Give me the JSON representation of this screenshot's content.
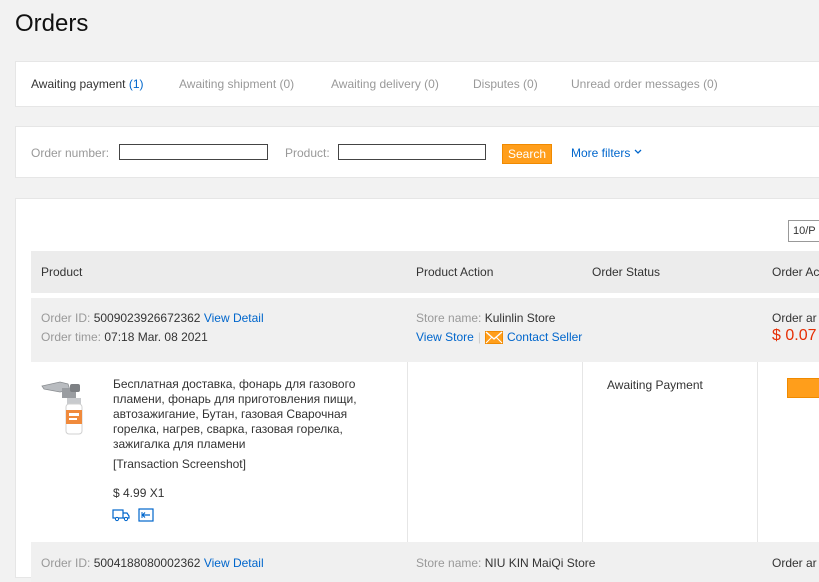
{
  "page": {
    "title": "Orders"
  },
  "tabs": [
    {
      "label": "Awaiting payment",
      "count": "(1)"
    },
    {
      "label": "Awaiting shipment (0)"
    },
    {
      "label": "Awaiting delivery (0)"
    },
    {
      "label": "Disputes (0)"
    },
    {
      "label": "Unread order messages (0)"
    }
  ],
  "filters": {
    "order_number_label": "Order number:",
    "product_label": "Product:",
    "search_label": "Search",
    "more_filters_label": "More filters"
  },
  "pager": {
    "label": "10/P"
  },
  "table": {
    "headers": [
      "Product",
      "Product Action",
      "Order Status",
      "Order Ac"
    ]
  },
  "orders": [
    {
      "id_label": "Order ID:",
      "id": "5009023926672362",
      "view_detail": "View Detail",
      "time_label": "Order time:",
      "time": "07:18 Mar. 08 2021",
      "store_label": "Store name:",
      "store": "Kulinlin Store",
      "view_store": "View Store",
      "contact_seller": "Contact Seller",
      "amount_label": "Order ar",
      "amount": "$ 0.07",
      "product_title": "Бесплатная доставка, фонарь для газового пламени, фонарь для приготовления пищи, автозажигание, Бутан, газовая Сварочная горелка, нагрев, сварка, газовая горелка, зажигалка для пламени",
      "transaction_screenshot": "[Transaction Screenshot]",
      "price": "$ 4.99 X1",
      "status": "Awaiting Payment"
    },
    {
      "id_label": "Order ID:",
      "id": "5004188080002362",
      "view_detail": "View Detail",
      "store_label": "Store name:",
      "store": "NIU KIN MaiQi Store",
      "amount_label": "Order ar"
    }
  ],
  "colors": {
    "accent_orange": "#ff9e1b",
    "link_blue": "#0066cc",
    "price_red": "#e62e04"
  }
}
